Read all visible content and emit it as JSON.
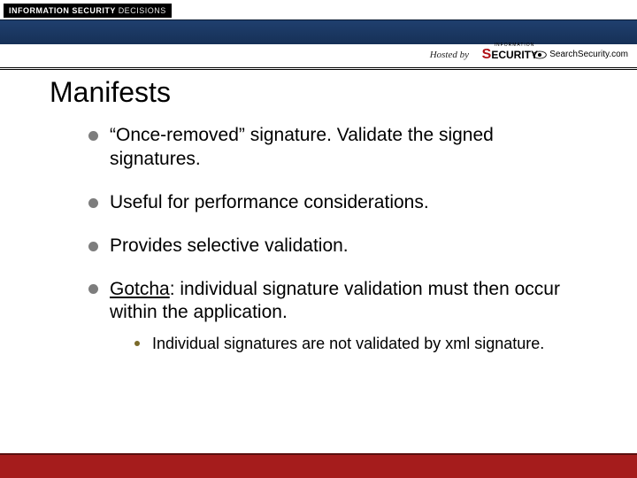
{
  "header": {
    "brand_main": "INFORMATION SECURITY",
    "brand_suffix": "DECISIONS",
    "hosted_by_label": "Hosted by",
    "sponsor1_prefix": "S",
    "sponsor1_rest": "ECURITY",
    "sponsor1_top": "INFORMATION",
    "sponsor2_text": "SearchSecurity.com"
  },
  "title": "Manifests",
  "bullets": [
    {
      "text": "“Once-removed” signature. Validate the signed signatures."
    },
    {
      "text": "Useful for performance considerations."
    },
    {
      "text": "Provides selective validation."
    },
    {
      "lead_underlined": "Gotcha",
      "rest": ": individual signature validation must then occur within the application.",
      "sub": [
        {
          "text": "Individual signatures are not validated by xml signature."
        }
      ]
    }
  ]
}
